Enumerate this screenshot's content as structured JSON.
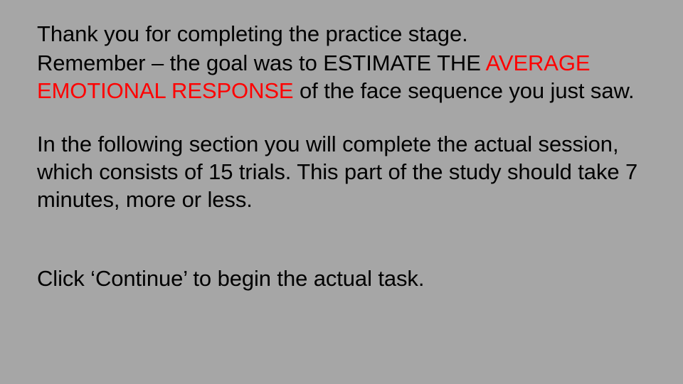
{
  "slide": {
    "line1": "Thank you for completing the practice stage.",
    "line2_before": "Remember – the goal was to ESTIMATE THE ",
    "line2_highlight": "AVERAGE EMOTIONAL RESPONSE",
    "line2_after": " of the face sequence you just saw.",
    "line3": "In the following section you will complete the actual session, which consists of 15 trials. This part of the study should take 7 minutes, more or less.",
    "line4": "Click ‘Continue’ to begin the actual task."
  },
  "colors": {
    "background": "#a6a6a6",
    "text": "#000000",
    "highlight": "#ff0000"
  }
}
